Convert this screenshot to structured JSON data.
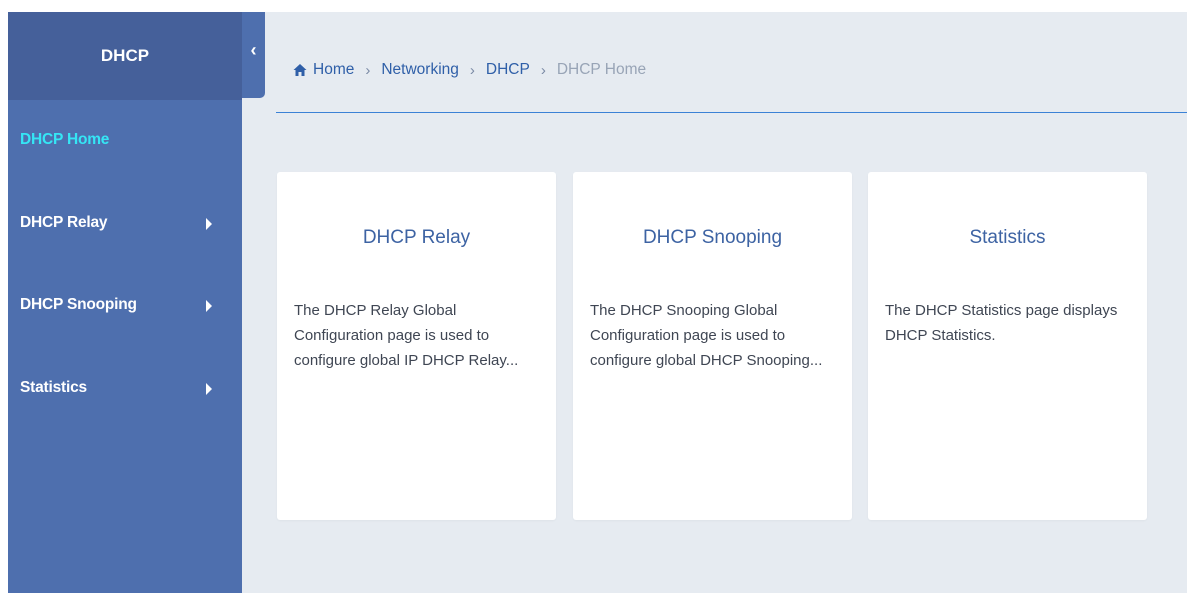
{
  "sidebar": {
    "title": "DHCP",
    "items": [
      {
        "label": "DHCP Home",
        "active": true
      },
      {
        "label": "DHCP Relay",
        "has_submenu": true
      },
      {
        "label": "DHCP Snooping",
        "has_submenu": true
      },
      {
        "label": "Statistics",
        "has_submenu": true
      }
    ],
    "collapse_glyph": "‹"
  },
  "breadcrumb": {
    "items": [
      "Home",
      "Networking",
      "DHCP"
    ],
    "current": "DHCP Home",
    "separator": "›"
  },
  "cards": [
    {
      "title": "DHCP Relay",
      "description": "The DHCP Relay Global Configuration page is used to configure global IP DHCP Relay..."
    },
    {
      "title": "DHCP Snooping",
      "description": "The DHCP Snooping Global Configuration page is used to configure global DHCP Snooping..."
    },
    {
      "title": "Statistics",
      "description": "The DHCP Statistics page displays DHCP Statistics."
    }
  ],
  "colors": {
    "sidebar": "#4e6fae",
    "sidebar_header": "#45609a",
    "active_item": "#35e6f5",
    "link": "#2f5fa8",
    "background": "#e6ebf1"
  },
  "icons": {
    "home": "home-icon",
    "collapse": "chevron-left-icon",
    "submenu": "caret-right-icon"
  }
}
